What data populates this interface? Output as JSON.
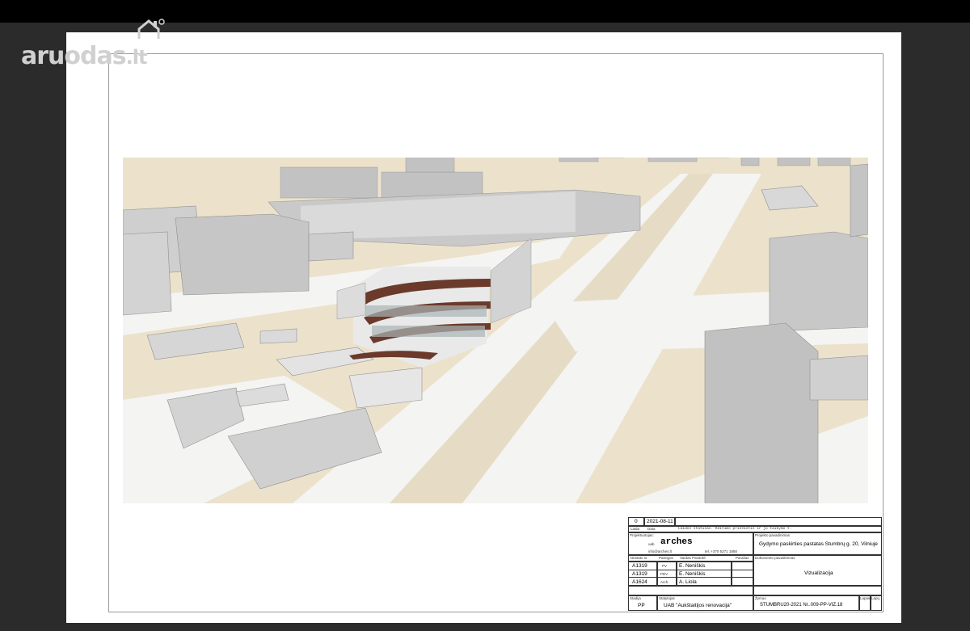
{
  "watermark": {
    "brand": "aruodas",
    "tld": ".lt"
  },
  "title_block": {
    "revision": {
      "number": "0",
      "date": "2021-08-11",
      "description": "Laidos statusas. Keitimo priežastis ir jo taikymo t."
    },
    "revision_headers": {
      "no": "Laida",
      "date": "Data"
    },
    "project_title_label": "Projekto pavadinimas",
    "project_title": "Gydymo paskirties pastatas Stumbrų g. 20, Vilniuje",
    "designer_label": "Projektuotojas:",
    "designer_prefix": "uab",
    "designer_name": "arches",
    "designer_email": "info@arches.lt",
    "designer_phone": "tel.:+370 5271 1858",
    "staff_headers": {
      "cert": "Atestato nr.",
      "role": "Pareigos",
      "name": "Vardas Pavardė",
      "sign": "Parašas"
    },
    "staff": [
      {
        "cert": "A1319",
        "role": "PV",
        "name": "E. Neniškis"
      },
      {
        "cert": "A1319",
        "role": "PDV",
        "name": "E. Neniškis"
      },
      {
        "cert": "A1624",
        "role": "Arch.",
        "name": "A. Liola"
      }
    ],
    "document_title_label": "Dokumento pavadinimas",
    "document_title": "Vizualizacija",
    "stage_label": "Stadija",
    "stage": "PP",
    "client_label": "Statytojas",
    "client": "UAB \"Aukštaitijos renovacija\"",
    "code_label": "Žymuo",
    "code": "STUMBRU20-2021 Nr..009-PP-VIZ.18",
    "sheet_label": "Lapas",
    "sheets_label": "Lapų"
  },
  "colors": {
    "ground": "#e9ddc4",
    "building": "#b7b7b7",
    "road": "#f3f3f3",
    "facade": "#6b3a2a"
  }
}
